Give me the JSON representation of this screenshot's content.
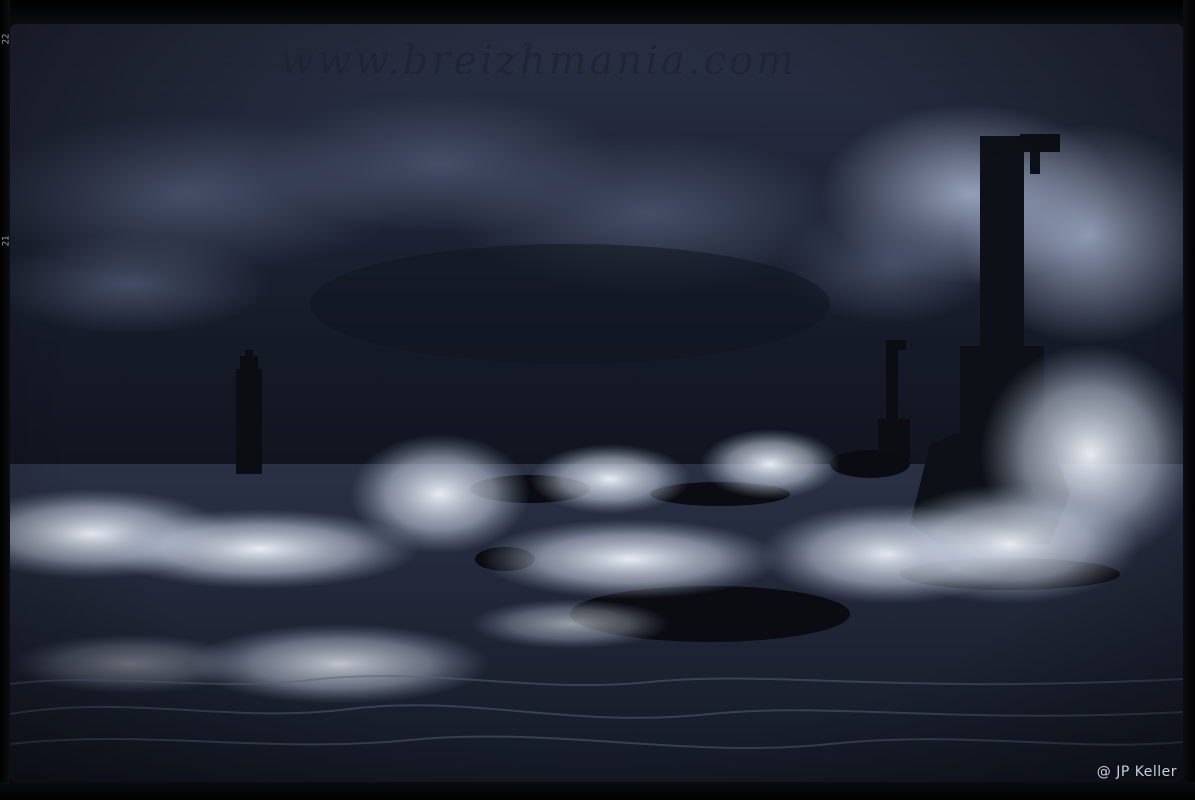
{
  "watermark": {
    "text": "www.breizhmania.com"
  },
  "credit": {
    "text": "@ JP Keller"
  },
  "film_edge": {
    "frame_numbers": [
      "22",
      "21"
    ]
  },
  "colors": {
    "sky": "#1f2536",
    "sky_light": "#9aa6c2",
    "sea": "#1a2030",
    "spray": "#e8eef8",
    "silhouette": "#0b0d12"
  },
  "scene": {
    "subject": "lighthouse-towers-in-storm-waves"
  }
}
